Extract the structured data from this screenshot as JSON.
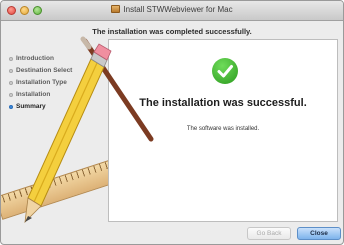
{
  "window": {
    "title": "Install STWWebviewer for Mac",
    "step_heading": "The installation was completed successfully."
  },
  "sidebar": {
    "steps": [
      {
        "label": "Introduction",
        "active": false
      },
      {
        "label": "Destination Select",
        "active": false
      },
      {
        "label": "Installation Type",
        "active": false
      },
      {
        "label": "Installation",
        "active": false
      },
      {
        "label": "Summary",
        "active": true
      }
    ]
  },
  "main": {
    "result_title": "The installation was successful.",
    "result_message": "The software was installed."
  },
  "buttons": {
    "back_label": "Go Back",
    "close_label": "Close"
  },
  "colors": {
    "success_green": "#2b9a1e",
    "active_step_dot": "#3d8ce0",
    "primary_button": "#7db3ec"
  },
  "icons": {
    "title": "package-icon",
    "result": "checkmark-circle-icon"
  }
}
